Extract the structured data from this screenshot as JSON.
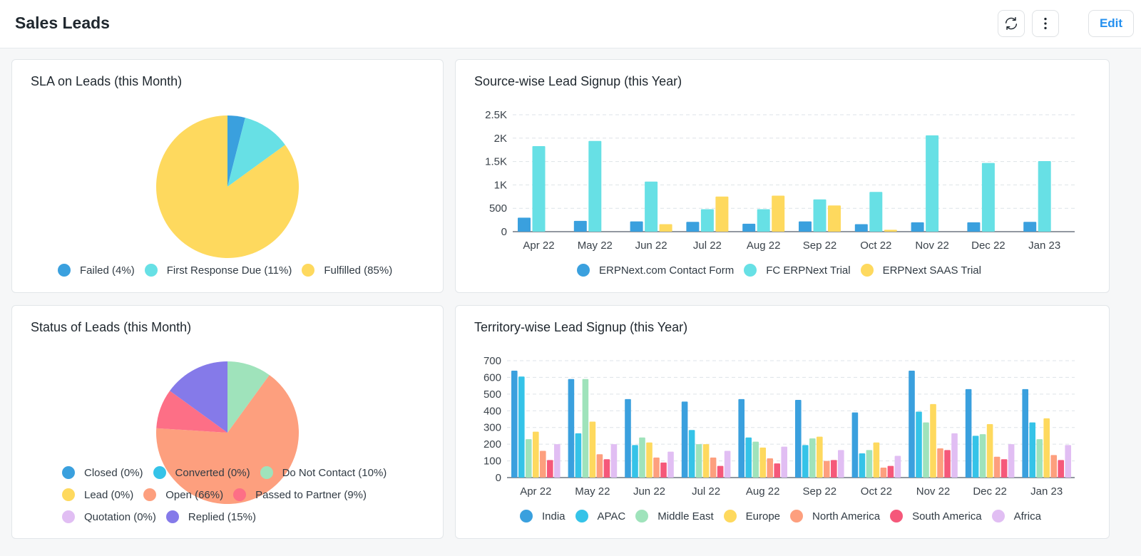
{
  "header": {
    "title": "Sales Leads",
    "refresh_icon": "refresh-icon",
    "menu_icon": "more-vertical-icon",
    "edit_label": "Edit"
  },
  "colors": {
    "accent": "#2490ef"
  },
  "charts": {
    "sla": {
      "title": "SLA on Leads (this Month)",
      "legend": [
        {
          "label": "Failed (4%)",
          "color": "#3aa0de"
        },
        {
          "label": "First Response Due (11%)",
          "color": "#67e0e5"
        },
        {
          "label": "Fulfilled (85%)",
          "color": "#fed95e"
        }
      ]
    },
    "source": {
      "title": "Source-wise Lead Signup (this Year)",
      "legend": [
        {
          "label": "ERPNext.com Contact Form",
          "color": "#3aa0de"
        },
        {
          "label": "FC ERPNext Trial",
          "color": "#67e0e5"
        },
        {
          "label": "ERPNext SAAS Trial",
          "color": "#fed95e"
        }
      ]
    },
    "status": {
      "title": "Status of Leads (this Month)",
      "legend": [
        {
          "label": "Closed (0%)",
          "color": "#3aa0de"
        },
        {
          "label": "Converted (0%)",
          "color": "#35c3e8"
        },
        {
          "label": "Do Not Contact (10%)",
          "color": "#9fe3bb"
        },
        {
          "label": "Lead (0%)",
          "color": "#fed95e"
        },
        {
          "label": "Open (66%)",
          "color": "#fd9f7e"
        },
        {
          "label": "Passed to Partner (9%)",
          "color": "#fd6f86"
        },
        {
          "label": "Quotation (0%)",
          "color": "#e1bef3"
        },
        {
          "label": "Replied (15%)",
          "color": "#857ae9"
        }
      ]
    },
    "territory": {
      "title": "Territory-wise Lead Signup (this Year)",
      "legend": [
        {
          "label": "India",
          "color": "#3aa0de"
        },
        {
          "label": "APAC",
          "color": "#35c3e8"
        },
        {
          "label": "Middle East",
          "color": "#9fe3bb"
        },
        {
          "label": "Europe",
          "color": "#fed95e"
        },
        {
          "label": "North America",
          "color": "#fd9f7e"
        },
        {
          "label": "South America",
          "color": "#f5587a"
        },
        {
          "label": "Africa",
          "color": "#e1bef3"
        }
      ]
    }
  },
  "chart_data": [
    {
      "type": "pie",
      "title": "SLA on Leads (this Month)",
      "labels": [
        "Failed",
        "First Response Due",
        "Fulfilled"
      ],
      "values": [
        4,
        11,
        85
      ],
      "colors": [
        "#3aa0de",
        "#67e0e5",
        "#fed95e"
      ],
      "legend_position": "bottom"
    },
    {
      "type": "bar",
      "title": "Source-wise Lead Signup (this Year)",
      "categories": [
        "Apr 22",
        "May 22",
        "Jun 22",
        "Jul 22",
        "Aug 22",
        "Sep 22",
        "Oct 22",
        "Nov 22",
        "Dec 22",
        "Jan 23"
      ],
      "ylim": [
        0,
        2500
      ],
      "yticks": [
        0,
        500,
        1000,
        1500,
        2000,
        2500
      ],
      "ytick_labels": [
        "0",
        "500",
        "1K",
        "1.5K",
        "2K",
        "2.5K"
      ],
      "grid": true,
      "legend_position": "bottom",
      "series": [
        {
          "name": "ERPNext.com Contact Form",
          "color": "#3aa0de",
          "values": [
            300,
            230,
            220,
            210,
            170,
            220,
            160,
            200,
            200,
            210
          ]
        },
        {
          "name": "FC ERPNext Trial",
          "color": "#67e0e5",
          "values": [
            1830,
            1940,
            1070,
            480,
            480,
            690,
            850,
            2060,
            1470,
            1510
          ]
        },
        {
          "name": "ERPNext SAAS Trial",
          "color": "#fed95e",
          "values": [
            0,
            0,
            160,
            750,
            770,
            560,
            40,
            0,
            0,
            0
          ]
        }
      ]
    },
    {
      "type": "pie",
      "title": "Status of Leads (this Month)",
      "labels": [
        "Closed",
        "Converted",
        "Do Not Contact",
        "Lead",
        "Open",
        "Passed to Partner",
        "Quotation",
        "Replied"
      ],
      "values": [
        0,
        0,
        10,
        0,
        66,
        9,
        0,
        15
      ],
      "colors": [
        "#3aa0de",
        "#35c3e8",
        "#9fe3bb",
        "#fed95e",
        "#fd9f7e",
        "#fd6f86",
        "#e1bef3",
        "#857ae9"
      ],
      "legend_position": "bottom"
    },
    {
      "type": "bar",
      "title": "Territory-wise Lead Signup (this Year)",
      "categories": [
        "Apr 22",
        "May 22",
        "Jun 22",
        "Jul 22",
        "Aug 22",
        "Sep 22",
        "Oct 22",
        "Nov 22",
        "Dec 22",
        "Jan 23"
      ],
      "ylim": [
        0,
        700
      ],
      "yticks": [
        0,
        100,
        200,
        300,
        400,
        500,
        600,
        700
      ],
      "ytick_labels": [
        "0",
        "100",
        "200",
        "300",
        "400",
        "500",
        "600",
        "700"
      ],
      "grid": true,
      "legend_position": "bottom",
      "series": [
        {
          "name": "India",
          "color": "#3aa0de",
          "values": [
            640,
            590,
            470,
            455,
            470,
            465,
            390,
            640,
            530,
            530
          ]
        },
        {
          "name": "APAC",
          "color": "#35c3e8",
          "values": [
            605,
            265,
            195,
            285,
            240,
            195,
            145,
            395,
            250,
            330
          ]
        },
        {
          "name": "Middle East",
          "color": "#9fe3bb",
          "values": [
            230,
            590,
            240,
            200,
            215,
            235,
            165,
            330,
            260,
            230
          ]
        },
        {
          "name": "Europe",
          "color": "#fed95e",
          "values": [
            275,
            335,
            210,
            200,
            180,
            245,
            210,
            440,
            320,
            355
          ]
        },
        {
          "name": "North America",
          "color": "#fd9f7e",
          "values": [
            160,
            140,
            120,
            120,
            115,
            100,
            60,
            175,
            125,
            135
          ]
        },
        {
          "name": "South America",
          "color": "#f5587a",
          "values": [
            105,
            110,
            90,
            70,
            85,
            105,
            70,
            165,
            110,
            105
          ]
        },
        {
          "name": "Africa",
          "color": "#e1bef3",
          "values": [
            200,
            200,
            155,
            160,
            185,
            165,
            130,
            265,
            200,
            195
          ]
        }
      ]
    }
  ]
}
